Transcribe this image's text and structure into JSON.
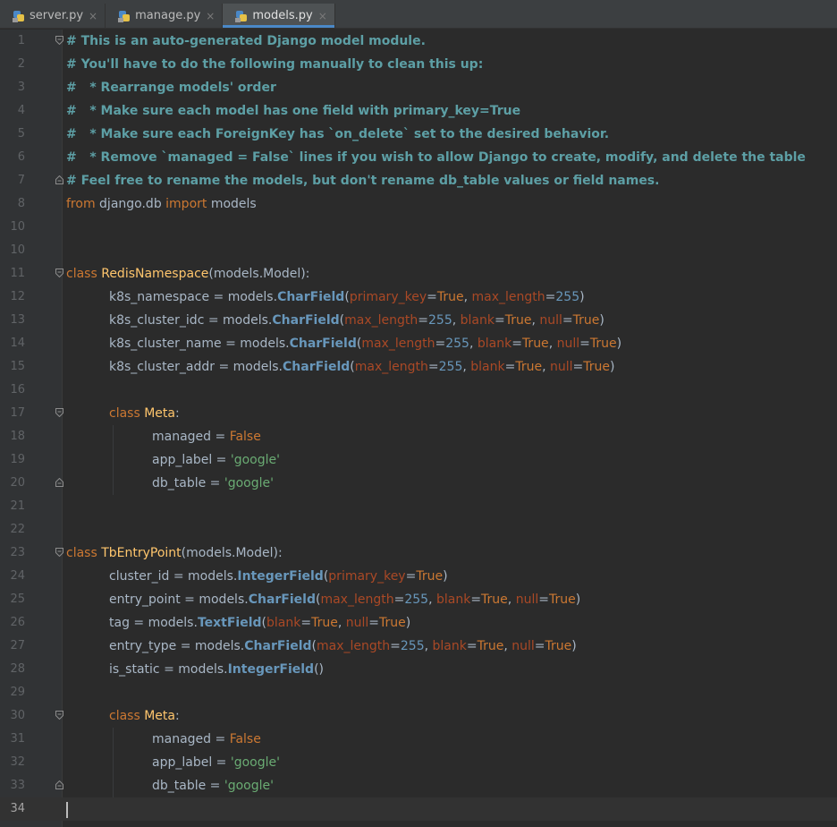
{
  "tabs": [
    {
      "label": "server.py",
      "active": false
    },
    {
      "label": "manage.py",
      "active": false
    },
    {
      "label": "models.py",
      "active": true
    }
  ],
  "close_glyph": "×",
  "current_line": 34,
  "lines": [
    {
      "n": "1",
      "t": [
        [
          "cm2",
          "# This is an auto-generated Django model module."
        ]
      ],
      "fold": "open",
      "indent": 0
    },
    {
      "n": "2",
      "t": [
        [
          "cm2",
          "# You'll have to do the following manually to clean this up:"
        ]
      ],
      "indent": 0
    },
    {
      "n": "3",
      "t": [
        [
          "cm2",
          "#   * Rearrange models' order"
        ]
      ],
      "indent": 0
    },
    {
      "n": "4",
      "t": [
        [
          "cm2",
          "#   * Make sure each model has one field with primary_key=True"
        ]
      ],
      "indent": 0
    },
    {
      "n": "5",
      "t": [
        [
          "cm2",
          "#   * Make sure each ForeignKey has `on_delete` set to the desired behavior."
        ]
      ],
      "indent": 0
    },
    {
      "n": "6",
      "t": [
        [
          "cm2",
          "#   * Remove `managed = False` lines if you wish to allow Django to create, modify, and delete the table"
        ]
      ],
      "indent": 0
    },
    {
      "n": "7",
      "t": [
        [
          "cm2",
          "# Feel free to rename the models, but don't rename db_table values or field names."
        ]
      ],
      "fold": "close",
      "indent": 0
    },
    {
      "n": "8",
      "t": [
        [
          "kw",
          "from"
        ],
        [
          "",
          " django.db "
        ],
        [
          "kw",
          "import"
        ],
        [
          "",
          " models"
        ]
      ],
      "indent": 0
    },
    {
      "n": "10",
      "t": [],
      "indent": 0
    },
    {
      "n": "10",
      "t": [],
      "indent": 0
    },
    {
      "n": "11",
      "t": [
        [
          "kw",
          "class"
        ],
        [
          "",
          " "
        ],
        [
          "cls",
          "RedisNamespace"
        ],
        [
          "",
          "(models.Model):"
        ]
      ],
      "fold": "open",
      "indent": 0
    },
    {
      "n": "12",
      "t": [
        [
          "",
          "k8s_namespace = models."
        ],
        [
          "bi",
          "CharField"
        ],
        [
          "",
          "("
        ],
        [
          "prm",
          "primary_key"
        ],
        [
          "",
          "="
        ],
        [
          "tr",
          "True"
        ],
        [
          "",
          ", "
        ],
        [
          "prm",
          "max_length"
        ],
        [
          "",
          "="
        ],
        [
          "num",
          "255"
        ],
        [
          "",
          ")"
        ]
      ],
      "indent": 1
    },
    {
      "n": "13",
      "t": [
        [
          "",
          "k8s_cluster_idc = models."
        ],
        [
          "bi",
          "CharField"
        ],
        [
          "",
          "("
        ],
        [
          "prm",
          "max_length"
        ],
        [
          "",
          "="
        ],
        [
          "num",
          "255"
        ],
        [
          "",
          ", "
        ],
        [
          "prm",
          "blank"
        ],
        [
          "",
          "="
        ],
        [
          "tr",
          "True"
        ],
        [
          "",
          ", "
        ],
        [
          "prm",
          "null"
        ],
        [
          "",
          "="
        ],
        [
          "tr",
          "True"
        ],
        [
          "",
          ")"
        ]
      ],
      "indent": 1
    },
    {
      "n": "14",
      "t": [
        [
          "",
          "k8s_cluster_name = models."
        ],
        [
          "bi",
          "CharField"
        ],
        [
          "",
          "("
        ],
        [
          "prm",
          "max_length"
        ],
        [
          "",
          "="
        ],
        [
          "num",
          "255"
        ],
        [
          "",
          ", "
        ],
        [
          "prm",
          "blank"
        ],
        [
          "",
          "="
        ],
        [
          "tr",
          "True"
        ],
        [
          "",
          ", "
        ],
        [
          "prm",
          "null"
        ],
        [
          "",
          "="
        ],
        [
          "tr",
          "True"
        ],
        [
          "",
          ")"
        ]
      ],
      "indent": 1
    },
    {
      "n": "15",
      "t": [
        [
          "",
          "k8s_cluster_addr = models."
        ],
        [
          "bi",
          "CharField"
        ],
        [
          "",
          "("
        ],
        [
          "prm",
          "max_length"
        ],
        [
          "",
          "="
        ],
        [
          "num",
          "255"
        ],
        [
          "",
          ", "
        ],
        [
          "prm",
          "blank"
        ],
        [
          "",
          "="
        ],
        [
          "tr",
          "True"
        ],
        [
          "",
          ", "
        ],
        [
          "prm",
          "null"
        ],
        [
          "",
          "="
        ],
        [
          "tr",
          "True"
        ],
        [
          "",
          ")"
        ]
      ],
      "indent": 1
    },
    {
      "n": "16",
      "t": [],
      "indent": 0
    },
    {
      "n": "17",
      "t": [
        [
          "kw",
          "class"
        ],
        [
          "",
          " "
        ],
        [
          "cls",
          "Meta"
        ],
        [
          "",
          ":"
        ]
      ],
      "fold": "open",
      "indent": 1
    },
    {
      "n": "18",
      "t": [
        [
          "",
          "managed = "
        ],
        [
          "kw",
          "False"
        ]
      ],
      "indent": 2
    },
    {
      "n": "19",
      "t": [
        [
          "",
          "app_label = "
        ],
        [
          "strg",
          "'google'"
        ]
      ],
      "indent": 2
    },
    {
      "n": "20",
      "t": [
        [
          "",
          "db_table = "
        ],
        [
          "strg",
          "'google'"
        ]
      ],
      "fold": "close",
      "indent": 2
    },
    {
      "n": "21",
      "t": [],
      "indent": 0
    },
    {
      "n": "22",
      "t": [],
      "indent": 0
    },
    {
      "n": "23",
      "t": [
        [
          "kw",
          "class"
        ],
        [
          "",
          " "
        ],
        [
          "cls",
          "TbEntryPoint"
        ],
        [
          "",
          "(models.Model):"
        ]
      ],
      "fold": "open",
      "indent": 0
    },
    {
      "n": "24",
      "t": [
        [
          "",
          "cluster_id = models."
        ],
        [
          "bi",
          "IntegerField"
        ],
        [
          "",
          "("
        ],
        [
          "prm",
          "primary_key"
        ],
        [
          "",
          "="
        ],
        [
          "tr",
          "True"
        ],
        [
          "",
          ")"
        ]
      ],
      "indent": 1
    },
    {
      "n": "25",
      "t": [
        [
          "",
          "entry_point = models."
        ],
        [
          "bi",
          "CharField"
        ],
        [
          "",
          "("
        ],
        [
          "prm",
          "max_length"
        ],
        [
          "",
          "="
        ],
        [
          "num",
          "255"
        ],
        [
          "",
          ", "
        ],
        [
          "prm",
          "blank"
        ],
        [
          "",
          "="
        ],
        [
          "tr",
          "True"
        ],
        [
          "",
          ", "
        ],
        [
          "prm",
          "null"
        ],
        [
          "",
          "="
        ],
        [
          "tr",
          "True"
        ],
        [
          "",
          ")"
        ]
      ],
      "indent": 1
    },
    {
      "n": "26",
      "t": [
        [
          "",
          "tag = models."
        ],
        [
          "bi",
          "TextField"
        ],
        [
          "",
          "("
        ],
        [
          "prm",
          "blank"
        ],
        [
          "",
          "="
        ],
        [
          "tr",
          "True"
        ],
        [
          "",
          ", "
        ],
        [
          "prm",
          "null"
        ],
        [
          "",
          "="
        ],
        [
          "tr",
          "True"
        ],
        [
          "",
          ")"
        ]
      ],
      "indent": 1
    },
    {
      "n": "27",
      "t": [
        [
          "",
          "entry_type = models."
        ],
        [
          "bi",
          "CharField"
        ],
        [
          "",
          "("
        ],
        [
          "prm",
          "max_length"
        ],
        [
          "",
          "="
        ],
        [
          "num",
          "255"
        ],
        [
          "",
          ", "
        ],
        [
          "prm",
          "blank"
        ],
        [
          "",
          "="
        ],
        [
          "tr",
          "True"
        ],
        [
          "",
          ", "
        ],
        [
          "prm",
          "null"
        ],
        [
          "",
          "="
        ],
        [
          "tr",
          "True"
        ],
        [
          "",
          ")"
        ]
      ],
      "indent": 1
    },
    {
      "n": "28",
      "t": [
        [
          "",
          "is_static = models."
        ],
        [
          "bi",
          "IntegerField"
        ],
        [
          "",
          "()"
        ]
      ],
      "indent": 1
    },
    {
      "n": "29",
      "t": [],
      "indent": 0
    },
    {
      "n": "30",
      "t": [
        [
          "kw",
          "class"
        ],
        [
          "",
          " "
        ],
        [
          "cls",
          "Meta"
        ],
        [
          "",
          ":"
        ]
      ],
      "fold": "open",
      "indent": 1
    },
    {
      "n": "31",
      "t": [
        [
          "",
          "managed = "
        ],
        [
          "kw",
          "False"
        ]
      ],
      "indent": 2
    },
    {
      "n": "32",
      "t": [
        [
          "",
          "app_label = "
        ],
        [
          "strg",
          "'google'"
        ]
      ],
      "indent": 2
    },
    {
      "n": "33",
      "t": [
        [
          "",
          "db_table = "
        ],
        [
          "strg",
          "'google'"
        ]
      ],
      "fold": "close",
      "indent": 2
    },
    {
      "n": "34",
      "t": [],
      "indent": 0
    }
  ]
}
